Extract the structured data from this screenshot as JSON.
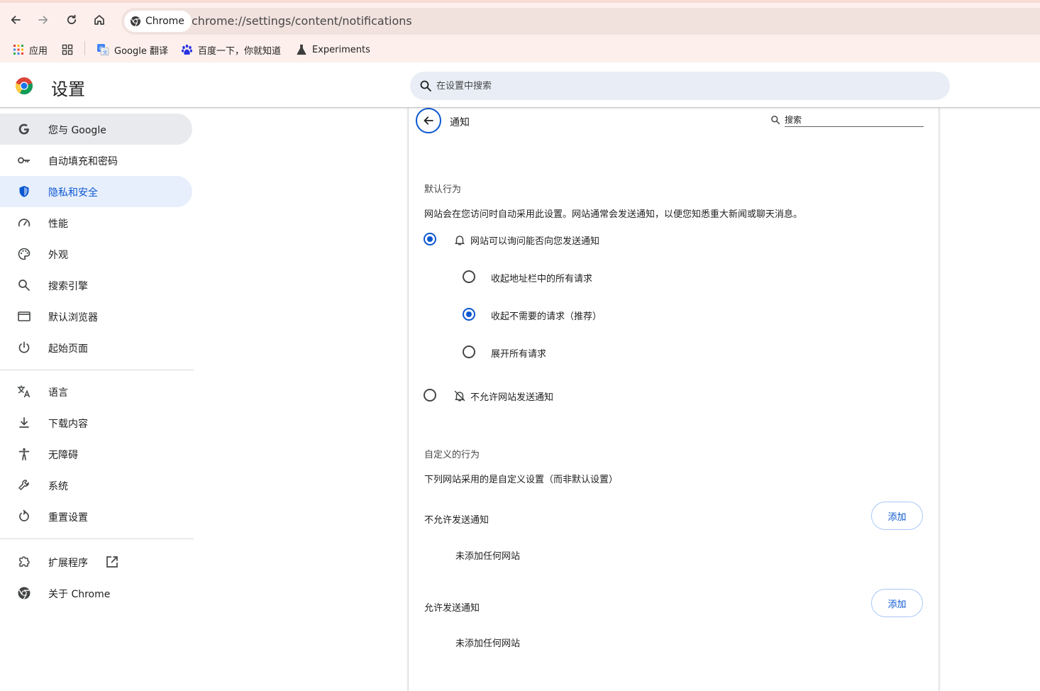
{
  "browser": {
    "site_chip": "Chrome",
    "url": "chrome://settings/content/notifications"
  },
  "bookmarks": [
    {
      "label": "应用",
      "icon": "apps-grid-icon"
    },
    {
      "label": "",
      "icon": "tab-groups-icon"
    },
    {
      "label": "Google 翻译",
      "icon": "google-translate-icon"
    },
    {
      "label": "百度一下，你就知道",
      "icon": "baidu-paw-icon"
    },
    {
      "label": "Experiments",
      "icon": "flask-icon"
    }
  ],
  "header": {
    "title": "设置",
    "search_placeholder": "在设置中搜索"
  },
  "sidebar": {
    "items": [
      {
        "label": "您与 Google",
        "icon": "google-g-icon",
        "state": "hover"
      },
      {
        "label": "自动填充和密码",
        "icon": "key-icon"
      },
      {
        "label": "隐私和安全",
        "icon": "shield-icon",
        "state": "selected"
      },
      {
        "label": "性能",
        "icon": "speedometer-icon"
      },
      {
        "label": "外观",
        "icon": "palette-icon"
      },
      {
        "label": "搜索引擎",
        "icon": "search-icon"
      },
      {
        "label": "默认浏览器",
        "icon": "browser-window-icon"
      },
      {
        "label": "起始页面",
        "icon": "power-icon"
      },
      {
        "label": "语言",
        "icon": "translate-icon"
      },
      {
        "label": "下载内容",
        "icon": "download-icon"
      },
      {
        "label": "无障碍",
        "icon": "accessibility-icon"
      },
      {
        "label": "系统",
        "icon": "wrench-icon"
      },
      {
        "label": "重置设置",
        "icon": "reset-icon"
      },
      {
        "label": "扩展程序",
        "icon": "puzzle-icon"
      },
      {
        "label": "关于 Chrome",
        "icon": "chrome-icon"
      }
    ]
  },
  "main": {
    "heading": "通知",
    "search_placeholder": "搜索",
    "default_behavior": {
      "title": "默认行为",
      "description": "网站会在您访问时自动采用此设置。网站通常会发送通知，以便您知悉重大新闻或聊天消息。",
      "option_allow_ask": "网站可以询问能否向您发送通知",
      "sub_options": [
        {
          "label": "收起地址栏中的所有请求",
          "checked": false
        },
        {
          "label": "收起不需要的请求（推荐）",
          "checked": true
        },
        {
          "label": "展开所有请求",
          "checked": false
        }
      ],
      "option_block": "不允许网站发送通知",
      "selected": "allow_ask"
    },
    "custom_behavior": {
      "title": "自定义的行为",
      "description": "下列网站采用的是自定义设置（而非默认设置）",
      "blocked": {
        "label": "不允许发送通知",
        "add_label": "添加",
        "empty": "未添加任何网站"
      },
      "allowed": {
        "label": "允许发送通知",
        "add_label": "添加",
        "empty": "未添加任何网站"
      }
    }
  },
  "colors": {
    "accent": "#0b57d0",
    "selected_bg": "#e7effd",
    "hover_bg": "#e8eaed",
    "toolbar_bg": "#fdf0ec"
  }
}
